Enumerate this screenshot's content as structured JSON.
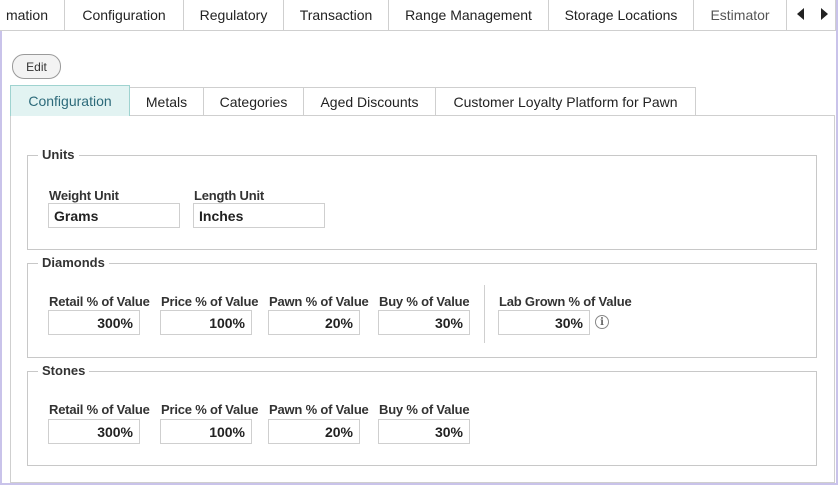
{
  "top_tabs": [
    {
      "label": "mation"
    },
    {
      "label": "Configuration"
    },
    {
      "label": "Regulatory"
    },
    {
      "label": "Transaction"
    },
    {
      "label": "Range Management"
    },
    {
      "label": "Storage Locations"
    },
    {
      "label": "Estimator",
      "active": true
    }
  ],
  "toolbar": {
    "edit_label": "Edit"
  },
  "inner_tabs": [
    {
      "label": "Configuration",
      "active": true
    },
    {
      "label": "Metals"
    },
    {
      "label": "Categories"
    },
    {
      "label": "Aged Discounts"
    },
    {
      "label": "Customer Loyalty Platform for Pawn"
    }
  ],
  "units": {
    "title": "Units",
    "weight_label": "Weight Unit",
    "weight_value": "Grams",
    "length_label": "Length Unit",
    "length_value": "Inches"
  },
  "diamonds": {
    "title": "Diamonds",
    "retail_label": "Retail % of Value",
    "retail_value": "300%",
    "price_label": "Price % of Value",
    "price_value": "100%",
    "pawn_label": "Pawn % of Value",
    "pawn_value": "20%",
    "buy_label": "Buy % of Value",
    "buy_value": "30%",
    "lab_label": "Lab Grown % of Value",
    "lab_value": "30%",
    "info_glyph": "i"
  },
  "stones": {
    "title": "Stones",
    "retail_label": "Retail % of Value",
    "retail_value": "300%",
    "price_label": "Price % of Value",
    "price_value": "100%",
    "pawn_label": "Pawn % of Value",
    "pawn_value": "20%",
    "buy_label": "Buy % of Value",
    "buy_value": "30%"
  },
  "colors": {
    "frame_border": "#c9c3ea",
    "active_inner_tab_bg": "#e2f3f2",
    "active_inner_tab_text": "#2c6a7a"
  }
}
